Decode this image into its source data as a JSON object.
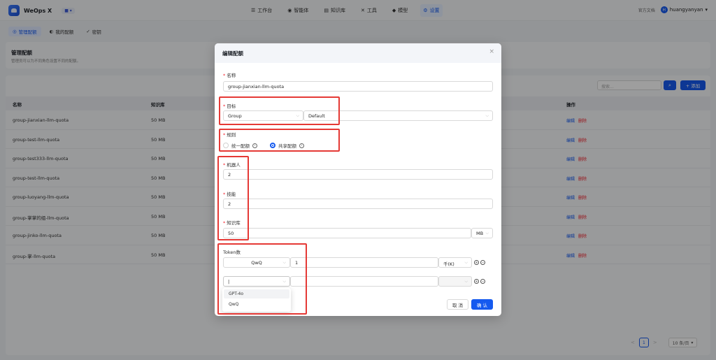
{
  "app": {
    "name": "WeOps X",
    "workspace_switch": "■ ▾"
  },
  "nav": [
    {
      "label": "工作台",
      "icon": "☰"
    },
    {
      "label": "智能体",
      "icon": "◉"
    },
    {
      "label": "知识库",
      "icon": "▤"
    },
    {
      "label": "工具",
      "icon": "✕"
    },
    {
      "label": "模型",
      "icon": "◆"
    },
    {
      "label": "设置",
      "icon": "⚙"
    }
  ],
  "top_right": {
    "doc_link": "官方文档",
    "user_initial": "H",
    "username": "huangyanyan"
  },
  "subtabs": [
    {
      "label": "管理配额",
      "icon": "◎"
    },
    {
      "label": "我的配额",
      "icon": "◐"
    },
    {
      "label": "密钥",
      "icon": "✓"
    }
  ],
  "page": {
    "title": "管理配额",
    "description": "管理员可以为不同角色设置不同的配额。"
  },
  "toolbar": {
    "search_placeholder": "搜索...",
    "search_icon": "🔍",
    "add_label": "+ 添加"
  },
  "table": {
    "headers": {
      "name": "名称",
      "kb": "知识库",
      "actions": "操作"
    },
    "rows": [
      {
        "name": "group-jianxian-llm-quota",
        "kb": "50 MB"
      },
      {
        "name": "group-test-llm-quota",
        "kb": "50 MB"
      },
      {
        "name": "group-test333-llm-quota",
        "kb": "50 MB"
      },
      {
        "name": "group-test-llm-quota",
        "kb": "50 MB"
      },
      {
        "name": "group-luoyang-llm-quota",
        "kb": "50 MB"
      },
      {
        "name": "group-掌掌的组-llm-quota",
        "kb": "50 MB"
      },
      {
        "name": "group-jinko-llm-quota",
        "kb": "50 MB"
      },
      {
        "name": "group-掌-llm-quota",
        "kb": "50 MB"
      }
    ],
    "edit_label": "编辑",
    "delete_label": "删除"
  },
  "pagination": {
    "prev": "<",
    "current": "1",
    "next": ">",
    "page_size": "10 条/页"
  },
  "modal": {
    "title": "编辑配额",
    "close": "×",
    "name_label": "名称",
    "name_value": "group-jianxian-llm-quota",
    "target_label": "目标",
    "target_type": "Group",
    "target_value": "Default",
    "rule_label": "规则",
    "rule_options": [
      "统一配额",
      "共享配额"
    ],
    "rule_selected": "共享配额",
    "bot_label": "机器人",
    "bot_value": "2",
    "skill_label": "技能",
    "skill_value": "2",
    "kb_label": "知识库",
    "kb_value": "50",
    "kb_unit": "MB",
    "token_label": "Token数",
    "token_rows": [
      {
        "model": "QwQ",
        "count": "1",
        "unit": "千(K)"
      },
      {
        "model": "|",
        "count": "",
        "unit": ""
      }
    ],
    "dropdown_options": [
      "GPT-4o",
      "QwQ"
    ],
    "cancel_label": "取 消",
    "ok_label": "确 认"
  },
  "colors": {
    "primary": "#155aef",
    "danger": "#f5222d",
    "annotation": "#e53935"
  }
}
